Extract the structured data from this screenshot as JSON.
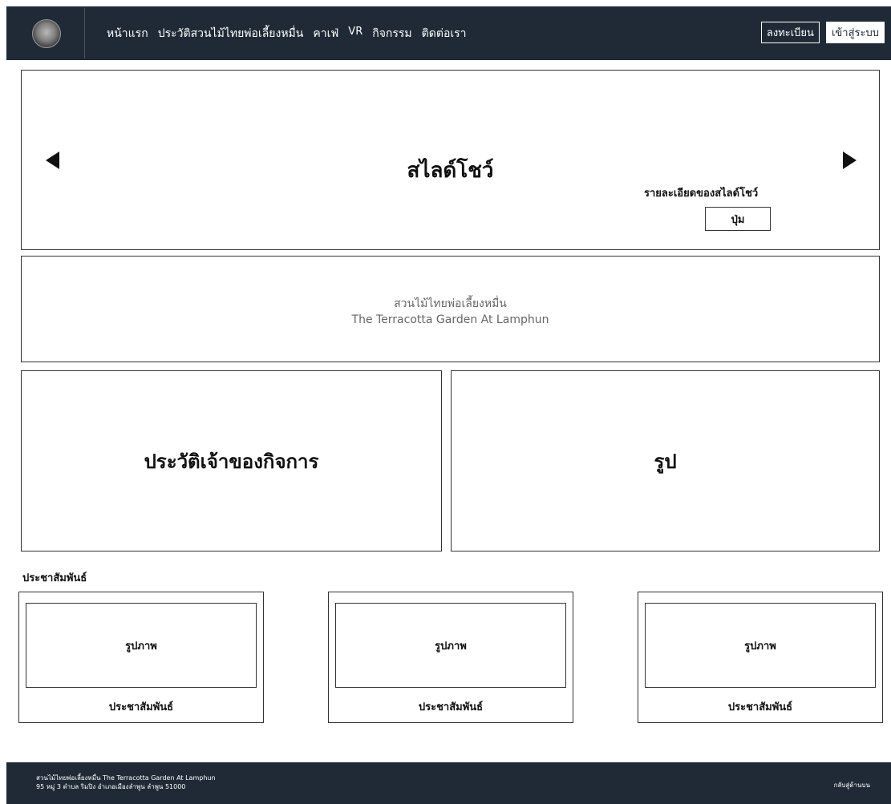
{
  "header": {
    "nav": [
      "หน้าแรก",
      "ประวัติสวนไม้ไทยพ่อเลี้ยงหมื่น",
      "คาเฟ่",
      "VR",
      "กิจกรรม",
      "ติดต่อเรา"
    ],
    "register_label": "ลงทะเบียน",
    "login_label": "เข้าสู่ระบบ"
  },
  "slideshow": {
    "title": "สไลด์โชว์",
    "detail": "รายละเอียดของสไลด์โชว์",
    "button_label": "ปุ่ม"
  },
  "intro": {
    "line1": "สวนไม้ไทยพ่อเลี้ยงหมื่น",
    "line2": "The Terracotta Garden At Lamphun"
  },
  "owner": {
    "title": "ประวัติเจ้าของกิจการ"
  },
  "picture": {
    "title": "รูป"
  },
  "pr": {
    "heading": "ประชาสัมพันธ์",
    "cards": [
      {
        "image_label": "รูปภาพ",
        "caption": "ประชาสัมพันธ์"
      },
      {
        "image_label": "รูปภาพ",
        "caption": "ประชาสัมพันธ์"
      },
      {
        "image_label": "รูปภาพ",
        "caption": "ประชาสัมพันธ์"
      }
    ]
  },
  "footer": {
    "line1": "สวนไม้ไทยพ่อเลี้ยงหมื่น The Terracotta Garden At Lamphun",
    "line2": "95 หมู่ 3 ตำบล ริมปิง อำเภอเมืองลำพูน ลำพูน 51000",
    "back_to_top": "กลับสู่ด้านบน"
  }
}
